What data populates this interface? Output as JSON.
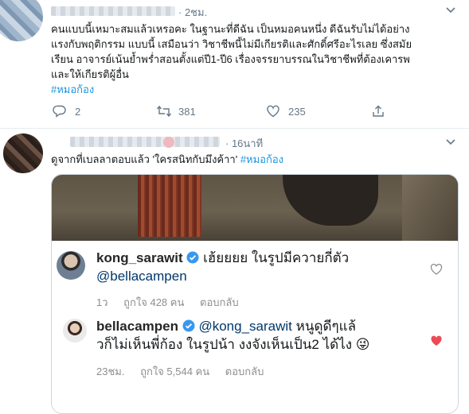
{
  "tweet1": {
    "time": "· 2ชม.",
    "text_line1": "คนแบบนี้เหมาะสมแล้วเหรอคะ ในฐานะที่ดีฉัน เป็นหมอคนหนึ่ง ดีฉันรับไม่ได้อย่าง",
    "text_line2": "แรงกับพฤติกรรม แบบนี้ เสมือนว่า วิชาชีพนี้ไม่มีเกียรติและศักดิ์ศรีอะไรเลย ซึ่งสมัย",
    "text_line3": "เรียน อาจารย์เน้นย้ำพร่ำสอนตั้งแต่ปี1-ปี6 เรื่องจรรยาบรรณในวิชาชีพที่ต้องเคารพ",
    "text_line4": "และให้เกียรติผู้อื่น",
    "hashtag": "#หมอก้อง",
    "replies": "2",
    "retweets": "381",
    "likes": "235"
  },
  "tweet2": {
    "time": "· 16นาที",
    "text": "ดูจากที่เบลลาตอบแล้ว 'ใครสนิทกับมึงค้าา'",
    "hashtag": "#หมอก้อง"
  },
  "ig_comment1": {
    "username": "kong_sarawit",
    "text": "เฮ้ยยยย ในรูปมีควายกี่ตัว",
    "mention": "@bellacampen",
    "time": "1ว",
    "likes": "ถูกใจ 428 คน",
    "reply": "ตอบกลับ"
  },
  "ig_comment2": {
    "username": "bellacampen",
    "mention": "@kong_sarawit",
    "text_a": "หนูดูดีๆแล้",
    "text_b": "วก็ไม่เห็นพี่ก้อง ในรูปน้า งงจังเห็นเป็น2 ได้ไง",
    "emoji": "😜",
    "time": "23ชม.",
    "likes": "ถูกใจ 5,544 คน",
    "reply": "ตอบกลับ"
  },
  "colors": {
    "link": "#1b95e0",
    "muted": "#657786",
    "verified": "#3897f0",
    "heart_red": "#ed4956"
  }
}
